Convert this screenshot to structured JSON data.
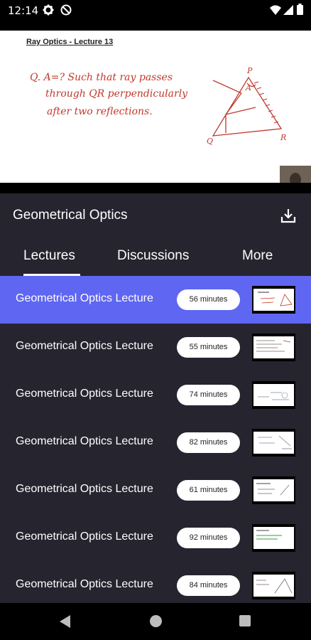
{
  "status_bar": {
    "time": "12:14"
  },
  "video": {
    "slide_title": "Ray Optics - Lecture 13",
    "handwriting": [
      "Q.  A=? Such that ray passes",
      "through QR perpendicularly",
      "after two reflections."
    ],
    "diagram_labels": [
      "P",
      "Q",
      "R",
      "A"
    ]
  },
  "course": {
    "title": "Geometrical Optics"
  },
  "tabs": [
    {
      "label": "Lectures"
    },
    {
      "label": "Discussions"
    },
    {
      "label": "More"
    }
  ],
  "lectures": [
    {
      "title": "Geometrical Optics Lecture",
      "duration": "56 minutes"
    },
    {
      "title": "Geometrical Optics Lecture",
      "duration": "55 minutes"
    },
    {
      "title": "Geometrical Optics Lecture",
      "duration": "74 minutes"
    },
    {
      "title": "Geometrical Optics Lecture",
      "duration": "82 minutes"
    },
    {
      "title": "Geometrical Optics Lecture",
      "duration": "61 minutes"
    },
    {
      "title": "Geometrical Optics Lecture",
      "duration": "92 minutes"
    },
    {
      "title": "Geometrical Optics Lecture",
      "duration": "84 minutes"
    }
  ],
  "colors": {
    "background": "#25242f",
    "active_row": "#5f66f2",
    "ink": "#c0392b"
  }
}
